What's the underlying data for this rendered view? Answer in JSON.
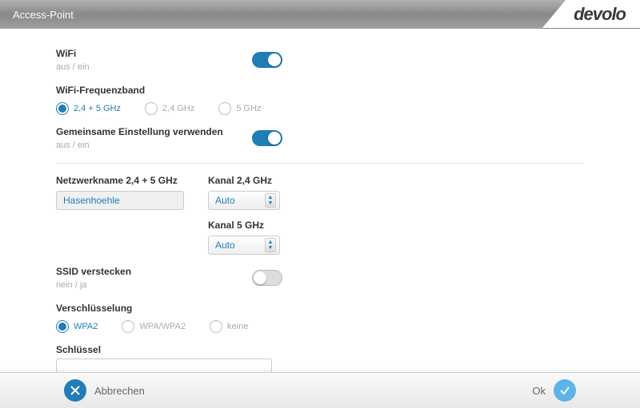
{
  "header": {
    "title": "Access-Point",
    "brand": "devolo"
  },
  "wifi": {
    "label": "WiFi",
    "sublabel": "aus / ein",
    "on": true
  },
  "freqband": {
    "label": "WiFi-Frequenzband",
    "options": [
      "2,4 + 5 GHz",
      "2,4 GHz",
      "5 GHz"
    ],
    "selected": 0
  },
  "shared": {
    "label": "Gemeinsame Einstellung verwenden",
    "sublabel": "aus / ein",
    "on": true
  },
  "network": {
    "name_label": "Netzwerkname 2,4 + 5 GHz",
    "name_value": "Hasenhoehle",
    "channel24_label": "Kanal 2,4 GHz",
    "channel24_value": "Auto",
    "channel5_label": "Kanal 5 GHz",
    "channel5_value": "Auto"
  },
  "ssid_hide": {
    "label": "SSID verstecken",
    "sublabel": "nein / ja",
    "on": false
  },
  "encryption": {
    "label": "Verschlüsselung",
    "options": [
      "WPA2",
      "WPA/WPA2",
      "keine"
    ],
    "selected": 0
  },
  "key": {
    "label": "Schlüssel"
  },
  "footer": {
    "cancel": "Abbrechen",
    "ok": "Ok"
  }
}
